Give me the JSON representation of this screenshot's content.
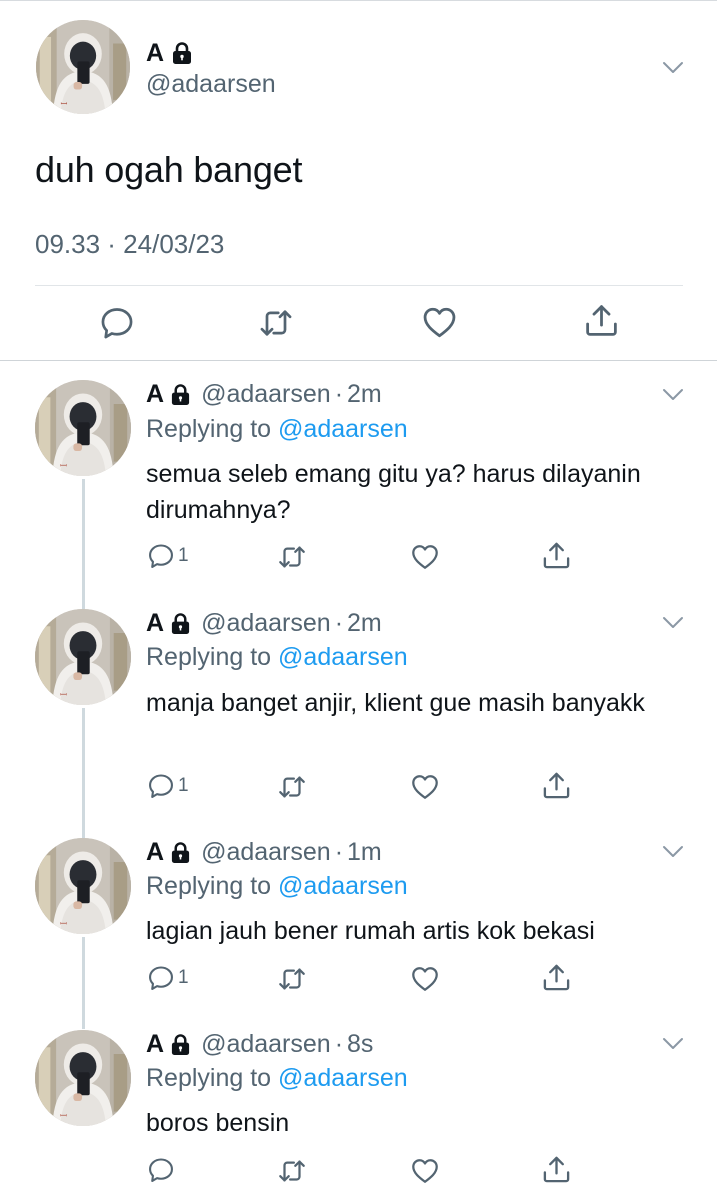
{
  "main_tweet": {
    "author_name": "A",
    "handle": "@adaarsen",
    "text": "duh ogah banget",
    "timestamp": "09.33 · 24/03/23",
    "icons": [
      "lock-icon",
      "chevron-down-icon",
      "reply-icon",
      "retweet-icon",
      "like-icon",
      "share-icon"
    ]
  },
  "replies": [
    {
      "author_name": "A",
      "handle": "@adaarsen",
      "separator": "·",
      "age": "2m",
      "replying_label": "Replying to",
      "replying_handle": "@adaarsen",
      "text": "semua seleb emang gitu ya? harus dilayanin dirumahnya?",
      "reply_count": "1"
    },
    {
      "author_name": "A",
      "handle": "@adaarsen",
      "separator": "·",
      "age": "2m",
      "replying_label": "Replying to",
      "replying_handle": "@adaarsen",
      "text": "manja banget anjir, klient gue masih banyakk",
      "reply_count": "1"
    },
    {
      "author_name": "A",
      "handle": "@adaarsen",
      "separator": "·",
      "age": "1m",
      "replying_label": "Replying to",
      "replying_handle": "@adaarsen",
      "text": "lagian jauh bener rumah artis kok bekasi",
      "reply_count": "1"
    },
    {
      "author_name": "A",
      "handle": "@adaarsen",
      "separator": "·",
      "age": "8s",
      "replying_label": "Replying to",
      "replying_handle": "@adaarsen",
      "text": "boros bensin",
      "reply_count": ""
    }
  ],
  "colors": {
    "text_primary": "#0f1419",
    "text_secondary": "#536471",
    "link": "#1d9bf0",
    "icon": "#536471",
    "thread_line": "#cfd9de"
  }
}
